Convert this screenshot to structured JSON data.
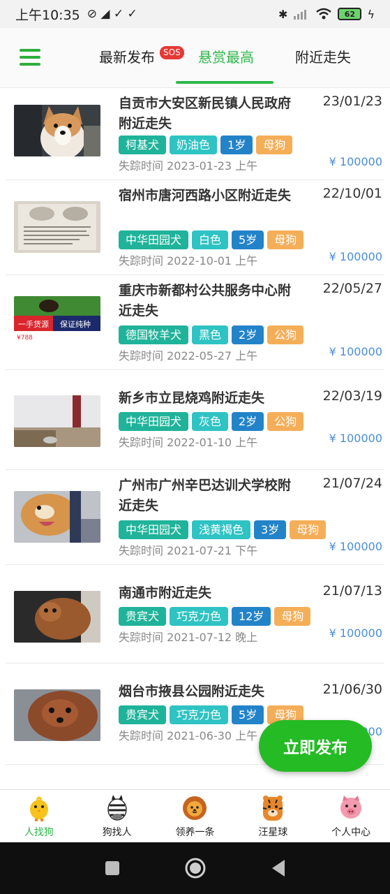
{
  "status_bar": {
    "time": "上午10:35",
    "left_icons": "⊘ ◢ ✓ ✓",
    "bluetooth": "✱",
    "battery": "62",
    "charge": "ϟ"
  },
  "top_tabs": {
    "menu_icon": "hamburger-icon",
    "tabs": [
      "最新发布",
      "悬赏最高",
      "附近走失"
    ],
    "sos_badge": "SOS",
    "active_tab": "悬赏最高",
    "accent_color": "#2db84a"
  },
  "listings": [
    {
      "title": "自贡市大安区新民镇人民政府附近走失",
      "date": "23/01/23",
      "breed": "柯基犬",
      "color": "奶油色",
      "age": "1岁",
      "sex": "母狗",
      "lost_time": "失踪时间 2023-01-23 上午",
      "reward": "¥ 100000"
    },
    {
      "title": "宿州市唐河西路小区附近走失",
      "date": "22/10/01",
      "breed": "中华田园犬",
      "color": "白色",
      "age": "5岁",
      "sex": "母狗",
      "lost_time": "失踪时间 2022-10-01 上午",
      "reward": "¥ 100000"
    },
    {
      "title": "重庆市新都村公共服务中心附近走失",
      "date": "22/05/27",
      "breed": "德国牧羊犬",
      "color": "黑色",
      "age": "2岁",
      "sex": "公狗",
      "lost_time": "失踪时间 2022-05-27 上午",
      "reward": "¥ 100000",
      "thumb_text": [
        "一手货源",
        "保证纯种",
        "¥788"
      ]
    },
    {
      "title": "新乡市立昆烧鸡附近走失",
      "date": "22/03/19",
      "breed": "中华田园犬",
      "color": "灰色",
      "age": "2岁",
      "sex": "公狗",
      "lost_time": "失踪时间 2022-01-10 上午",
      "reward": "¥ 100000"
    },
    {
      "title": "广州市广州辛巴达训犬学校附近走失",
      "date": "21/07/24",
      "breed": "中华田园犬",
      "color": "浅黄褐色",
      "age": "3岁",
      "sex": "母狗",
      "lost_time": "失踪时间 2021-07-21 下午",
      "reward": "¥ 100000"
    },
    {
      "title": "南通市附近走失",
      "date": "21/07/13",
      "breed": "贵宾犬",
      "color": "巧克力色",
      "age": "12岁",
      "sex": "母狗",
      "lost_time": "失踪时间 2021-07-12 晚上",
      "reward": "¥ 100000"
    },
    {
      "title": "烟台市掖县公园附近走失",
      "date": "21/06/30",
      "breed": "贵宾犬",
      "color": "巧克力色",
      "age": "5岁",
      "sex": "母狗",
      "lost_time": "失踪时间 2021-06-30 上午",
      "reward": "¥ 100000"
    }
  ],
  "fab": {
    "label": "立即发布"
  },
  "bottom_nav": [
    {
      "label": "人找狗",
      "icon": "chick-icon",
      "active": true
    },
    {
      "label": "狗找人",
      "icon": "zebra-icon"
    },
    {
      "label": "领养一条",
      "icon": "lion-icon"
    },
    {
      "label": "汪星球",
      "icon": "tiger-icon"
    },
    {
      "label": "个人中心",
      "icon": "pig-icon"
    }
  ],
  "system_nav": [
    "recent-apps-icon",
    "home-icon",
    "back-icon"
  ]
}
